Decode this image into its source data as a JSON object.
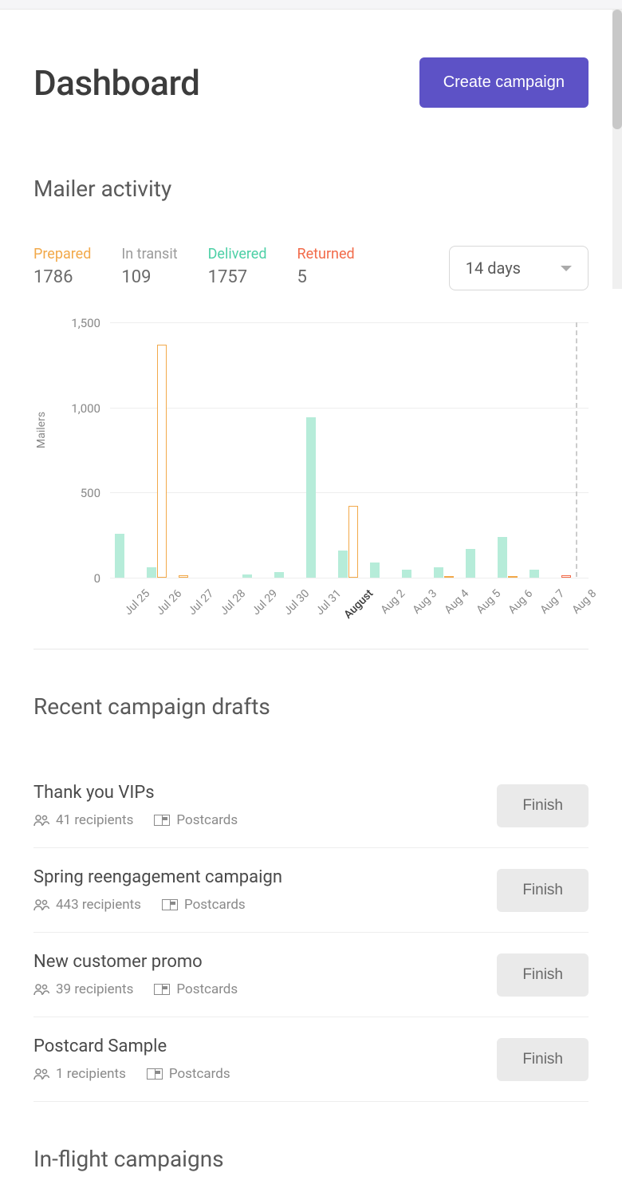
{
  "header": {
    "title": "Dashboard",
    "create_campaign_label": "Create campaign"
  },
  "mailer_activity": {
    "title": "Mailer activity",
    "stats": {
      "prepared": {
        "label": "Prepared",
        "value": "1786"
      },
      "in_transit": {
        "label": "In transit",
        "value": "109"
      },
      "delivered": {
        "label": "Delivered",
        "value": "1757"
      },
      "returned": {
        "label": "Returned",
        "value": "5"
      }
    },
    "range_selector": {
      "selected": "14 days"
    }
  },
  "chart_data": {
    "type": "bar",
    "ylabel": "Mailers",
    "ylim": [
      0,
      1500
    ],
    "y_ticks": [
      0,
      500,
      1000,
      1500
    ],
    "categories": [
      "Jul 25",
      "Jul 26",
      "Jul 27",
      "Jul 28",
      "Jul 29",
      "Jul 30",
      "Jul 31",
      "August",
      "Aug 2",
      "Aug 3",
      "Aug 4",
      "Aug 5",
      "Aug 6",
      "Aug 7",
      "Aug 8"
    ],
    "emphasized_category": "August",
    "series": [
      {
        "name": "Delivered",
        "values": [
          260,
          60,
          0,
          0,
          20,
          35,
          940,
          160,
          90,
          45,
          60,
          170,
          240,
          45,
          0
        ]
      },
      {
        "name": "Prepared",
        "values": [
          0,
          1370,
          15,
          0,
          0,
          0,
          0,
          420,
          0,
          0,
          5,
          0,
          10,
          0,
          0
        ]
      },
      {
        "name": "Returned",
        "values": [
          0,
          0,
          0,
          0,
          0,
          0,
          0,
          0,
          0,
          0,
          0,
          0,
          0,
          0,
          15
        ]
      }
    ]
  },
  "recent_drafts": {
    "title": "Recent campaign drafts",
    "finish_label": "Finish",
    "type_label": "Postcards",
    "items": [
      {
        "title": "Thank you VIPs",
        "recipients": "41 recipients"
      },
      {
        "title": "Spring reengagement campaign",
        "recipients": "443 recipients"
      },
      {
        "title": "New customer promo",
        "recipients": "39 recipients"
      },
      {
        "title": "Postcard Sample",
        "recipients": "1 recipients"
      }
    ]
  },
  "in_flight": {
    "title": "In-flight campaigns"
  }
}
